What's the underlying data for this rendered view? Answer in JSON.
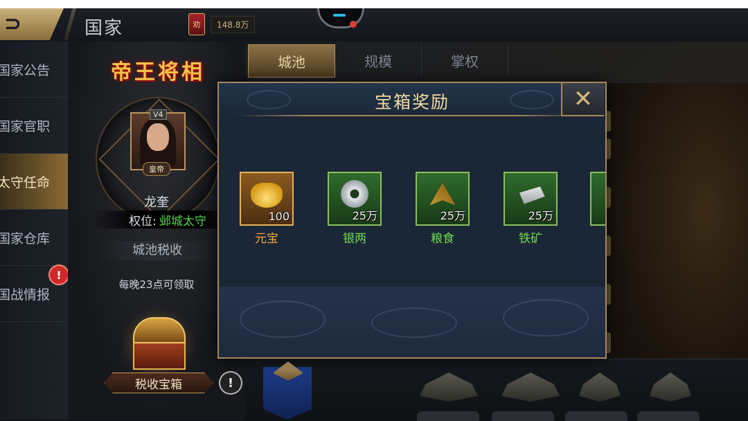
{
  "header": {
    "back_label": "⊃",
    "title": "国家",
    "currency_icon_text": "劝",
    "currency_value": "148.8万"
  },
  "sidebar": {
    "items": [
      {
        "label": "国家公告",
        "active": false
      },
      {
        "label": "国家官职",
        "active": false
      },
      {
        "label": "太守任命",
        "active": true
      },
      {
        "label": "国家仓库",
        "active": false
      },
      {
        "label": "国战情报",
        "active": false
      }
    ],
    "alert_badge": "!"
  },
  "profile": {
    "emblem_text": "帝王将相",
    "vip_level": "V4",
    "rank_tag": "皇帝",
    "name": "龙奎",
    "position_label": "权位:",
    "position_value": "邺城太守",
    "tax_section_title": "城池税收",
    "tax_note": "每晚23点可领取",
    "chest_button_label": "税收宝箱",
    "help_label": "!"
  },
  "main": {
    "tabs": [
      {
        "label": "城池",
        "active": true
      },
      {
        "label": "规模",
        "active": false
      },
      {
        "label": "掌权",
        "active": false
      }
    ]
  },
  "modal": {
    "title": "宝箱奖励",
    "close_label": "✕",
    "rewards": [
      {
        "name": "元宝",
        "quantity": "100",
        "icon": "gold-ingot-icon",
        "name_color": "#f0a83c"
      },
      {
        "name": "银两",
        "quantity": "25万",
        "icon": "silver-coin-icon",
        "name_color": "#6fdb4f"
      },
      {
        "name": "粮食",
        "quantity": "25万",
        "icon": "grain-icon",
        "name_color": "#6fdb4f"
      },
      {
        "name": "铁矿",
        "quantity": "25万",
        "icon": "iron-ingot-icon",
        "name_color": "#6fdb4f"
      }
    ]
  },
  "colors": {
    "accent_gold": "#a9885a",
    "active_green": "#56d24a",
    "alert_red": "#d02828"
  }
}
